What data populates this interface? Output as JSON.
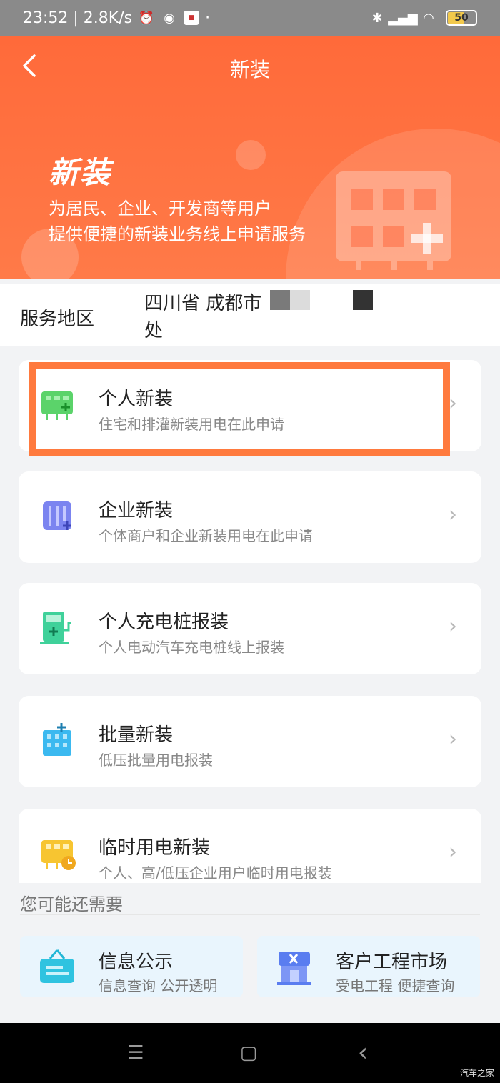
{
  "status_bar": {
    "time_speed": "23:52 | 2.8K/s",
    "dot": "·",
    "battery": "50",
    "icons": [
      "alarm-icon",
      "app-icon",
      "app-chip-icon",
      "bluetooth-icon",
      "signal-icon",
      "wifi-icon",
      "battery-icon"
    ]
  },
  "header": {
    "title": "新装",
    "hero_title": "新装",
    "hero_sub1": "为居民、企业、开发商等用户",
    "hero_sub2": "提供便捷的新装业务线上申请服务",
    "back_icon": "chevron-left-icon"
  },
  "service_area": {
    "label": "服务地区",
    "value": "四川省 成都市 处"
  },
  "services": [
    {
      "name": "个人新装",
      "desc": "住宅和排灌新装用电在此申请",
      "icon": "personal-install-icon",
      "color": "#5bd36a"
    },
    {
      "name": "企业新装",
      "desc": "个体商户和企业新装用电在此申请",
      "icon": "enterprise-install-icon",
      "color": "#7b84f0"
    },
    {
      "name": "个人充电桩报装",
      "desc": "个人电动汽车充电桩线上报装",
      "icon": "charging-pile-icon",
      "color": "#3fd19a"
    },
    {
      "name": "批量新装",
      "desc": "低压批量用电报装",
      "icon": "batch-install-icon",
      "color": "#3bb9f0"
    },
    {
      "name": "临时用电新装",
      "desc": "个人、高/低压企业用户临时用电报装",
      "icon": "temporary-power-icon",
      "color": "#f7c531"
    }
  ],
  "recommend": {
    "title": "您可能还需要",
    "items": [
      {
        "name": "信息公示",
        "desc": "信息查询 公开透明",
        "icon": "info-board-icon"
      },
      {
        "name": "客户工程市场",
        "desc": "受电工程 便捷查询",
        "icon": "engineering-market-icon"
      }
    ]
  },
  "navbar": {
    "menu": "☰",
    "home": "▢",
    "back": "‹"
  },
  "watermark": "汽车之家",
  "colors": {
    "brand": "#ff6a3a",
    "highlight": "#ff7a3e"
  }
}
